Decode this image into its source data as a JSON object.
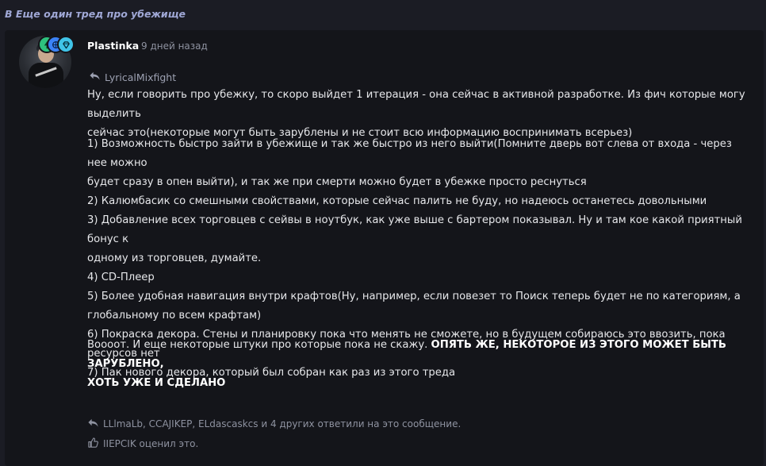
{
  "thread": {
    "title": "В Еще один тред про убежище"
  },
  "post": {
    "author": "Plastinka",
    "time": "9 дней назад",
    "quoted_user": "LyricalMixfight",
    "body": {
      "intro_line1": "Ну, если говорить про убежку, то скоро выйдет 1 итерация - она сейчас в активной разработке. Из фич которые могу выделить",
      "intro_line2": "сейчас это(некоторые могут быть зарублены и не стоит всю информацию воспринимать всерьез)",
      "item1_line1": "1) Возможность быстро зайти в убежище и так же быстро из него выйти(Помните дверь вот слева от входа - через нее можно",
      "item1_line2": "будет сразу в опен выйти), и так же при смерти можно будет в убежке просто реснуться",
      "item2": "2) Калюмбасик со смешными свойствами, которые сейчас палить не буду, но надеюсь останетесь довольными",
      "item3_line1": "3) Добавление всех торговцев с сейвы в ноутбук, как уже выше с бартером показывал. Ну и там кое какой приятный бонус к",
      "item3_line2": "одному из торговцев, думайте.",
      "item4": "4) CD-Плеер",
      "item5_line1": "5) Более удобная навигация внутри крафтов(Ну, например, если повезет то Поиск теперь будет не по категориям, а",
      "item5_line2": "глобальному по всем крафтам)",
      "item6": "6) Покраска декора. Стены и планировку пока что менять не сможете, но в будущем собираюсь это ввозить, пока ресурсов нет",
      "item7": "7) Пак нового декора, который был собран как раз из этого треда",
      "outro_text": "Воооот. И еще некоторые штуки про которые пока не скажу. ",
      "outro_bold_line1": "ОПЯТЬ ЖЕ, НЕКОТОРОЕ ИЗ ЭТОГО МОЖЕТ БЫТЬ ЗАРУБЛЕНО,",
      "outro_bold_line2": "ХОТЬ УЖЕ И СДЕЛАНО"
    },
    "replies_text": "LLlmaLb, CCAJIKEP, ELdascaskcs и 4 других ответили на это сообщение.",
    "likes_text": "IIEPCIK оценил это.",
    "badges": [
      "tree-icon",
      "globe-icon",
      "diamond-icon"
    ]
  },
  "colors": {
    "background": "#1b1c24",
    "card": "#14151a",
    "thread_title": "#a0a8d6",
    "muted": "#8e92a0"
  }
}
